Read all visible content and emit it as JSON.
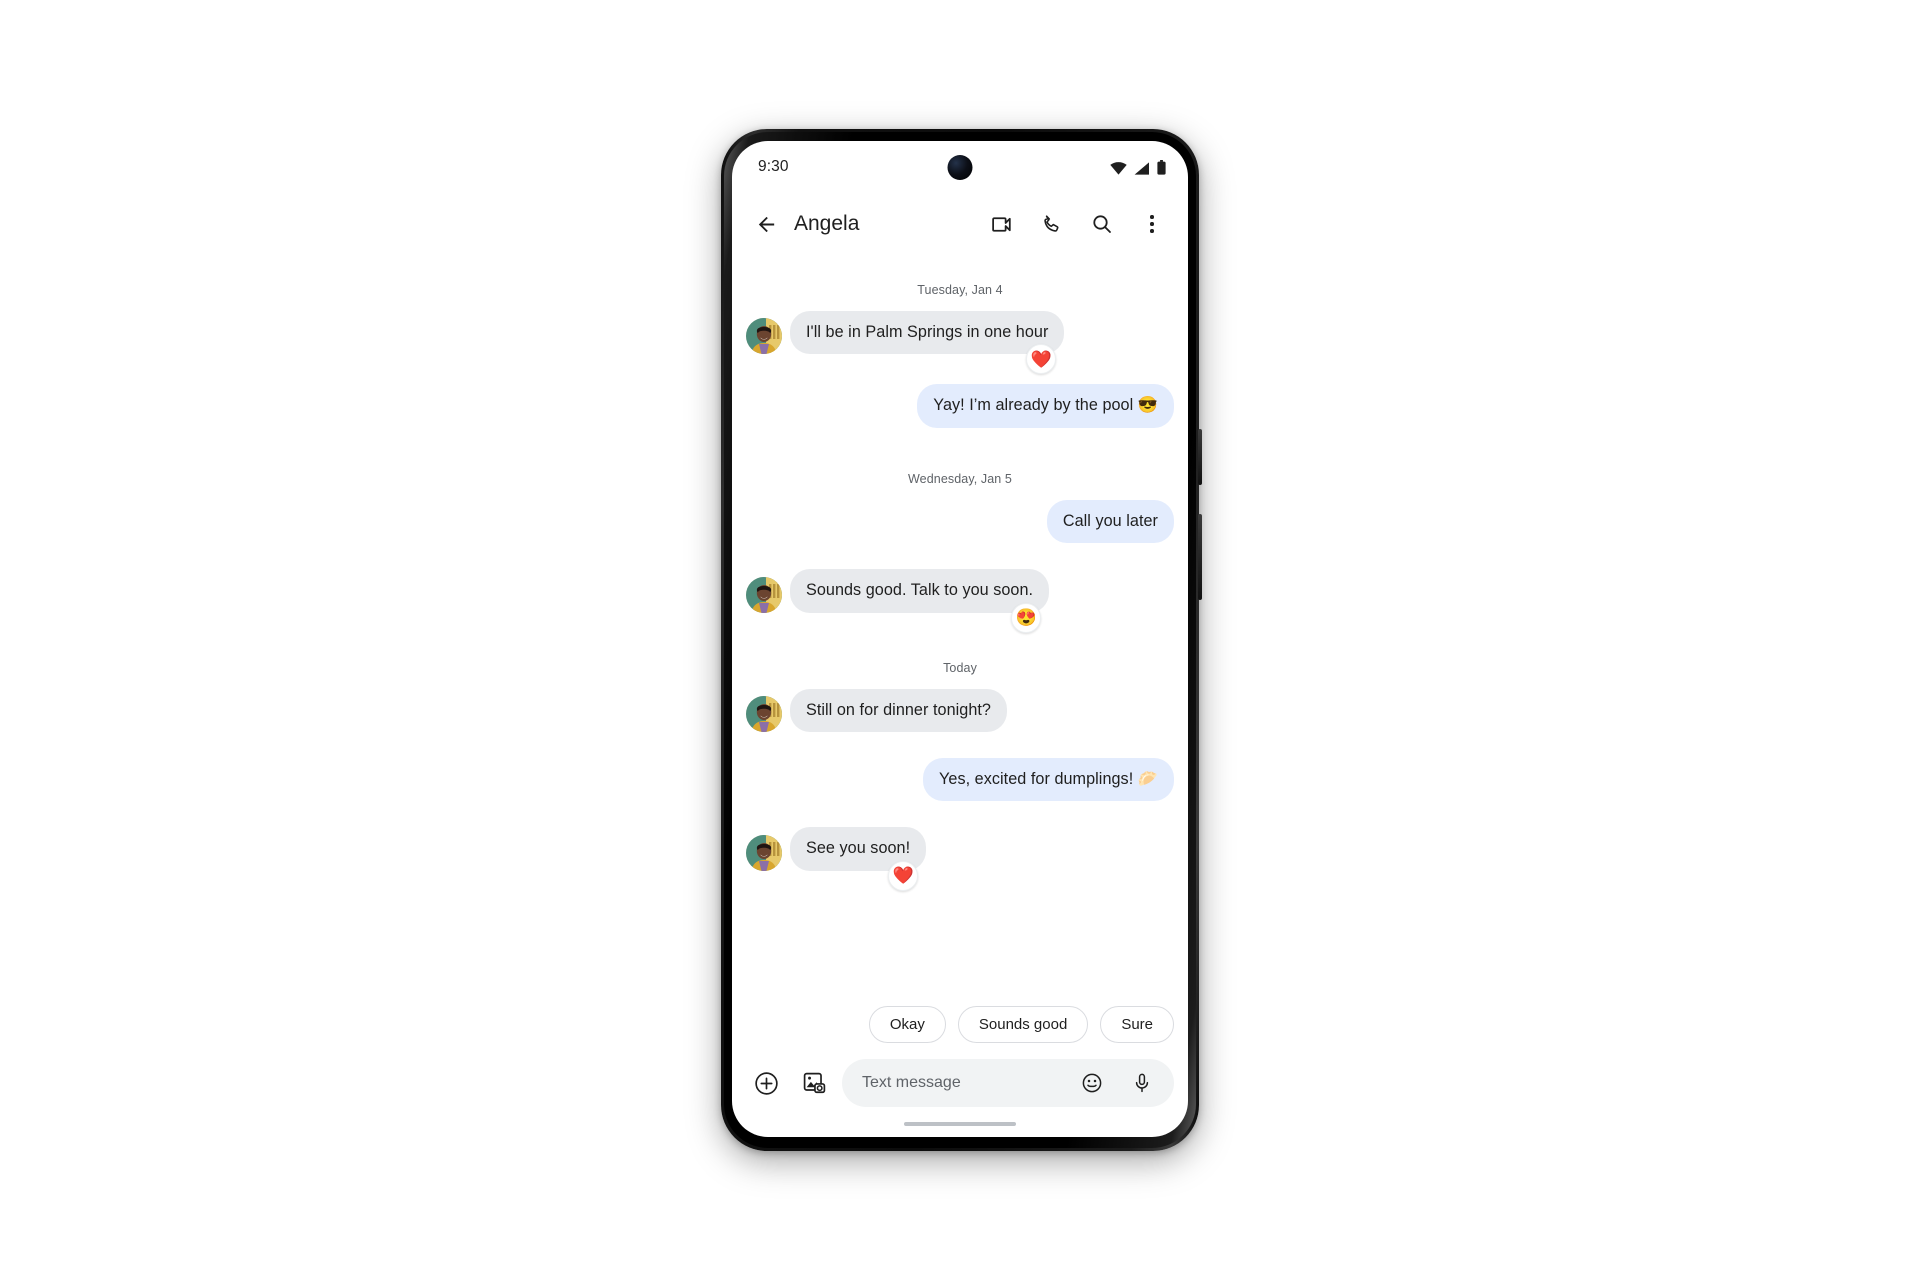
{
  "status_bar": {
    "time": "9:30",
    "icons": [
      "wifi-icon",
      "cellular-signal-icon",
      "battery-icon"
    ]
  },
  "app_bar": {
    "back_icon": "back-arrow-icon",
    "contact_name": "Angela",
    "actions": [
      {
        "name": "video-call-icon",
        "label": "Video call"
      },
      {
        "name": "phone-call-icon",
        "label": "Call"
      },
      {
        "name": "search-icon",
        "label": "Search"
      },
      {
        "name": "overflow-menu-icon",
        "label": "More options"
      }
    ]
  },
  "conversation": {
    "groups": [
      {
        "date_label": "Tuesday, Jan 4",
        "messages": [
          {
            "direction": "incoming",
            "text": "I'll be in Palm Springs in one hour",
            "avatar": true,
            "reaction": "❤️"
          },
          {
            "direction": "outgoing",
            "text": "Yay! I’m already by the pool 😎",
            "avatar": false,
            "reaction": ""
          }
        ]
      },
      {
        "date_label": "Wednesday, Jan 5",
        "messages": [
          {
            "direction": "outgoing",
            "text": "Call you later",
            "avatar": false,
            "reaction": ""
          },
          {
            "direction": "incoming",
            "text": "Sounds good. Talk to you soon.",
            "avatar": true,
            "reaction": "😍"
          }
        ]
      },
      {
        "date_label": "Today",
        "messages": [
          {
            "direction": "incoming",
            "text": "Still on for dinner tonight?",
            "avatar": true,
            "reaction": ""
          },
          {
            "direction": "outgoing",
            "text": "Yes, excited for dumplings! 🥟",
            "avatar": false,
            "reaction": ""
          },
          {
            "direction": "incoming",
            "text": "See you soon!",
            "avatar": true,
            "reaction": "❤️"
          }
        ]
      }
    ]
  },
  "smart_reply_chips": [
    {
      "label": "Okay"
    },
    {
      "label": "Sounds good"
    },
    {
      "label": "Sure"
    }
  ],
  "compose_bar": {
    "add_icon": "plus-circle-icon",
    "gallery_icon": "gallery-camera-icon",
    "placeholder": "Text message",
    "emoji_icon": "emoji-smiley-icon",
    "mic_icon": "microphone-icon"
  },
  "colors": {
    "incoming_bubble": "#e8eaed",
    "outgoing_bubble": "#e3ecfd",
    "text_primary": "#1f1f1f",
    "text_secondary": "#5f6368",
    "chip_border": "#dadce0",
    "compose_field": "#f1f3f4"
  }
}
